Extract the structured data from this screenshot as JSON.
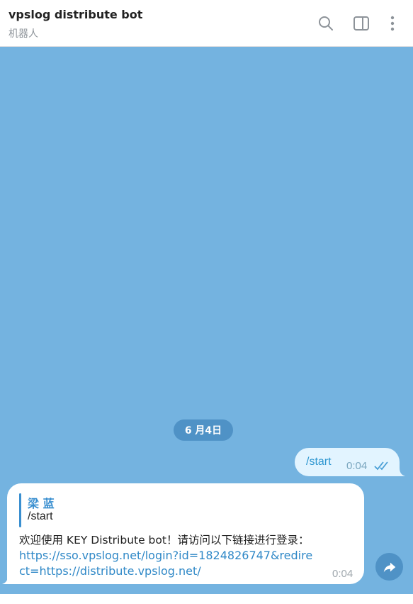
{
  "header": {
    "title": "vpslog distribute bot",
    "subtitle": "机器人",
    "icons": [
      "search-icon",
      "side-panel-icon",
      "more-icon"
    ]
  },
  "chat": {
    "date_label": "6 月4日",
    "outgoing": {
      "text": "/start",
      "time": "0:04",
      "status": "read"
    },
    "incoming": {
      "reply_to_name": "梁 蓝",
      "reply_to_text": "/start",
      "text": "欢迎使用 KEY Distribute bot！请访问以下链接进行登录：",
      "link": "https://sso.vpslog.net/login?id=1824826747&redirect=https://distribute.vpslog.net/",
      "time": "0:04"
    },
    "share_icon": "share-icon"
  },
  "colors": {
    "chat_background": "#74b3e0",
    "outgoing_bubble": "#e2f4ff",
    "incoming_bubble": "#ffffff",
    "accent": "#3a8fd0",
    "date_pill": "#4f92c6"
  }
}
